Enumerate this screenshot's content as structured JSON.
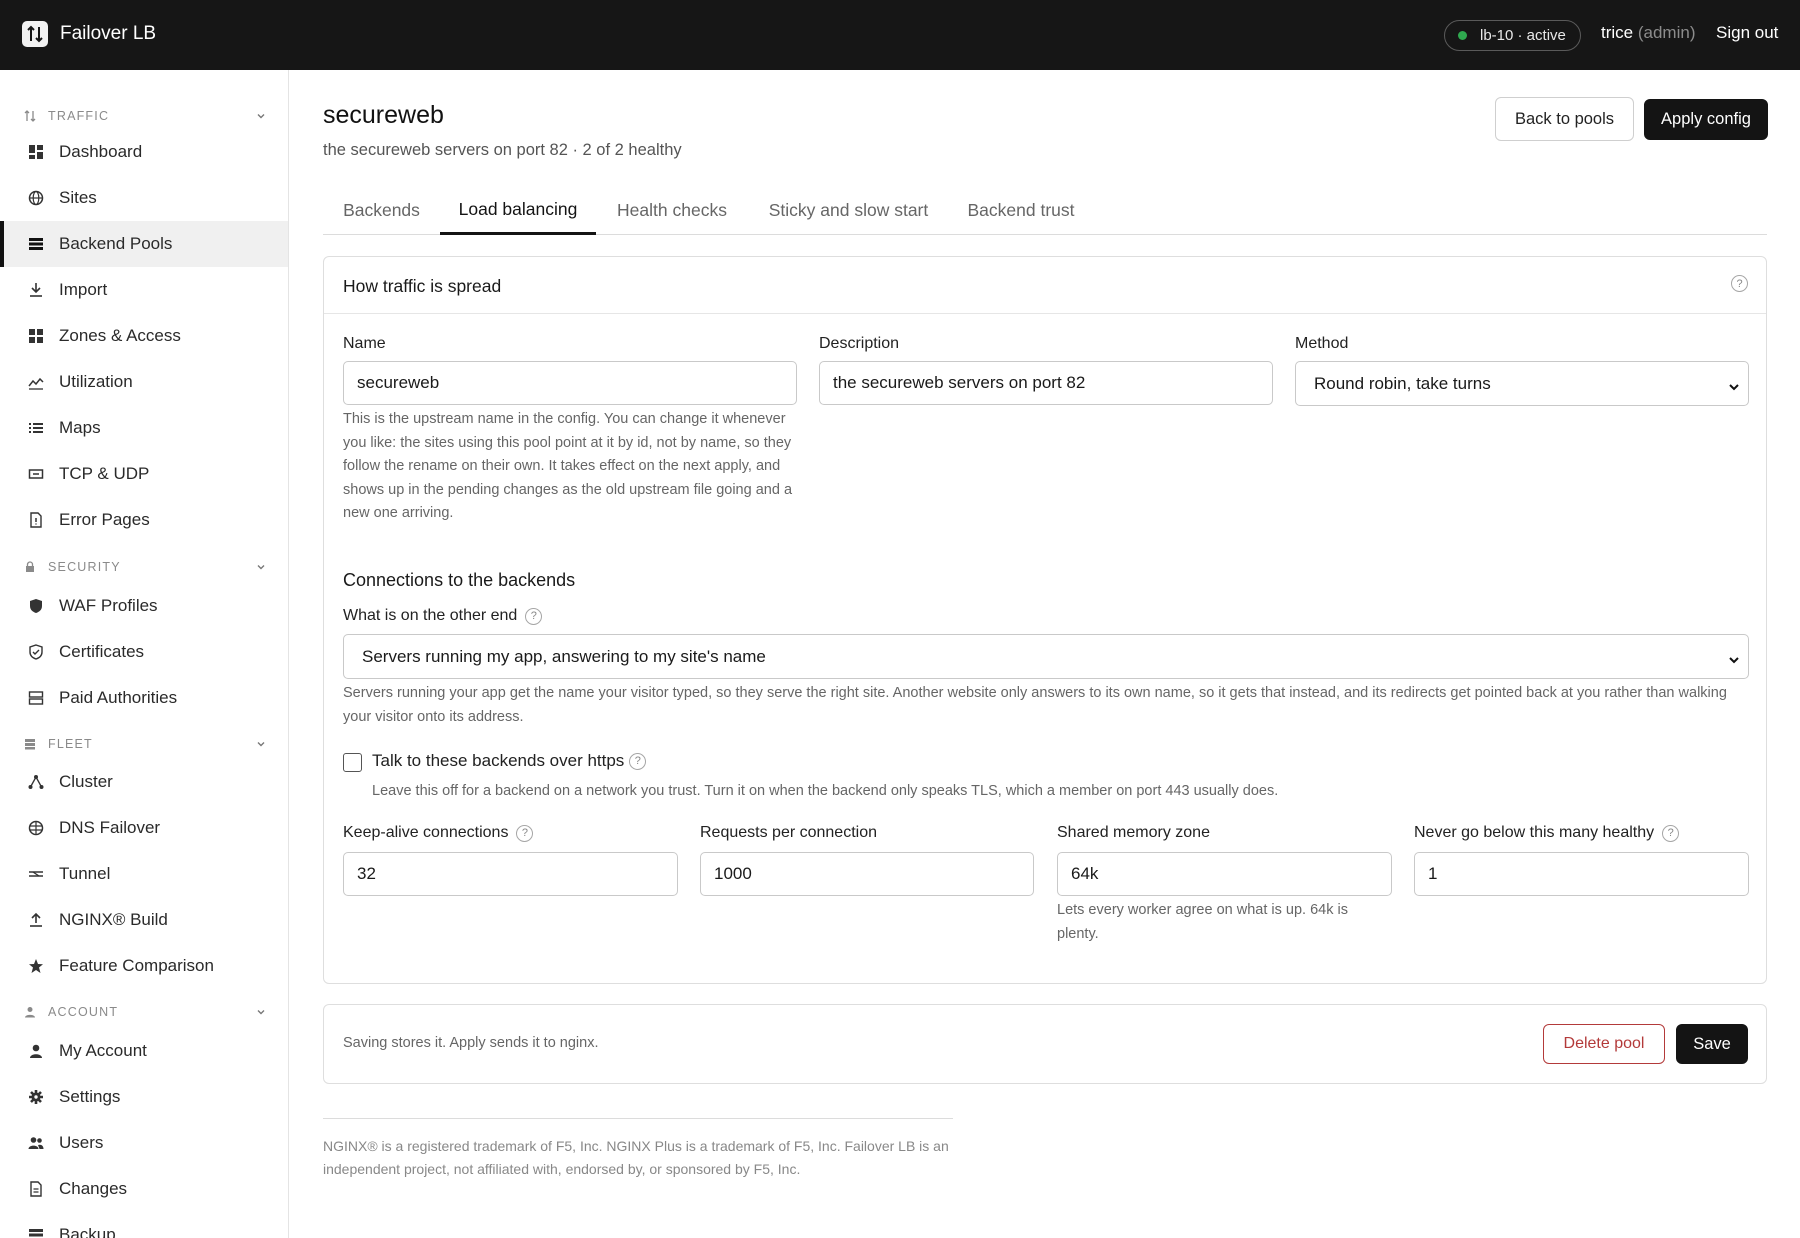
{
  "app": {
    "name": "Failover LB"
  },
  "topbar": {
    "node_status": "lb-10 · active",
    "user_name": "trice",
    "user_role": "(admin)",
    "sign_out": "Sign out"
  },
  "sidebar": {
    "sections": [
      {
        "title": "TRAFFIC",
        "icon": "traffic-icon",
        "items": [
          {
            "label": "Dashboard",
            "icon": "dashboard-icon"
          },
          {
            "label": "Sites",
            "icon": "globe-icon"
          },
          {
            "label": "Backend Pools",
            "icon": "server-stack-icon",
            "active": true
          },
          {
            "label": "Import",
            "icon": "download-icon"
          },
          {
            "label": "Zones & Access",
            "icon": "grid-icon"
          },
          {
            "label": "Utilization",
            "icon": "line-chart-icon"
          },
          {
            "label": "Maps",
            "icon": "list-icon"
          },
          {
            "label": "TCP & UDP",
            "icon": "port-icon"
          },
          {
            "label": "Error Pages",
            "icon": "error-file-icon"
          }
        ]
      },
      {
        "title": "SECURITY",
        "icon": "lock-icon",
        "items": [
          {
            "label": "WAF Profiles",
            "icon": "shield-icon"
          },
          {
            "label": "Certificates",
            "icon": "shield-check-icon"
          },
          {
            "label": "Paid Authorities",
            "icon": "authority-icon"
          }
        ]
      },
      {
        "title": "FLEET",
        "icon": "fleet-icon",
        "items": [
          {
            "label": "Cluster",
            "icon": "cluster-icon"
          },
          {
            "label": "DNS Failover",
            "icon": "dns-globe-icon"
          },
          {
            "label": "Tunnel",
            "icon": "tunnel-icon"
          },
          {
            "label": "NGINX® Build",
            "icon": "upload-icon"
          },
          {
            "label": "Feature Comparison",
            "icon": "star-icon"
          }
        ]
      },
      {
        "title": "ACCOUNT",
        "icon": "account-icon",
        "items": [
          {
            "label": "My Account",
            "icon": "person-icon"
          },
          {
            "label": "Settings",
            "icon": "gear-icon"
          },
          {
            "label": "Users",
            "icon": "users-icon"
          },
          {
            "label": "Changes",
            "icon": "changes-file-icon"
          },
          {
            "label": "Backup",
            "icon": "backup-icon"
          }
        ]
      }
    ]
  },
  "page": {
    "title": "secureweb",
    "subtitle": "the secureweb servers on port 82 · 2 of 2 healthy",
    "back_button": "Back to pools",
    "apply_button": "Apply config"
  },
  "tabs": [
    {
      "label": "Backends",
      "active": false
    },
    {
      "label": "Load balancing",
      "active": true
    },
    {
      "label": "Health checks",
      "active": false
    },
    {
      "label": "Sticky and slow start",
      "active": false
    },
    {
      "label": "Backend trust",
      "active": false
    }
  ],
  "card": {
    "title": "How traffic is spread",
    "help": "?",
    "name_label": "Name",
    "name_value": "secureweb",
    "name_hint": "This is the upstream name in the config. You can change it whenever you like: the sites using this pool point at it by id, not by name, so they follow the rename on their own. It takes effect on the next apply, and shows up in the pending changes as the old upstream file going and a new one arriving.",
    "desc_label": "Description",
    "desc_value": "the secureweb servers on port 82",
    "method_label": "Method",
    "method_value": "Round robin, take turns",
    "connections_heading": "Connections to the backends",
    "other_end_label": "What is on the other end",
    "other_end_value": "Servers running my app, answering to my site's name",
    "other_end_hint": "Servers running your app get the name your visitor typed, so they serve the right site. Another website only answers to its own name, so it gets that instead, and its redirects get pointed back at you rather than walking your visitor onto its address.",
    "https_label": "Talk to these backends over https",
    "https_checked": false,
    "https_hint": "Leave this off for a backend on a network you trust. Turn it on when the backend only speaks TLS, which a member on port 443 usually does.",
    "keepalive_label": "Keep-alive connections",
    "keepalive_value": "32",
    "requests_label": "Requests per connection",
    "requests_value": "1000",
    "zone_label": "Shared memory zone",
    "zone_value": "64k",
    "zone_hint": "Lets every worker agree on what is up. 64k is plenty.",
    "min_healthy_label": "Never go below this many healthy",
    "min_healthy_value": "1"
  },
  "save_bar": {
    "note": "Saving stores it. Apply sends it to nginx.",
    "delete_button": "Delete pool",
    "save_button": "Save"
  },
  "footer": {
    "note": "NGINX® is a registered trademark of F5, Inc. NGINX Plus is a trademark of F5, Inc. Failover LB is an independent project, not affiliated with, endorsed by, or sponsored by F5, Inc."
  },
  "colors": {
    "topbar_bg": "#161616",
    "status_green": "#2fa84f",
    "danger": "#b33a3a",
    "primary": "#141414"
  }
}
